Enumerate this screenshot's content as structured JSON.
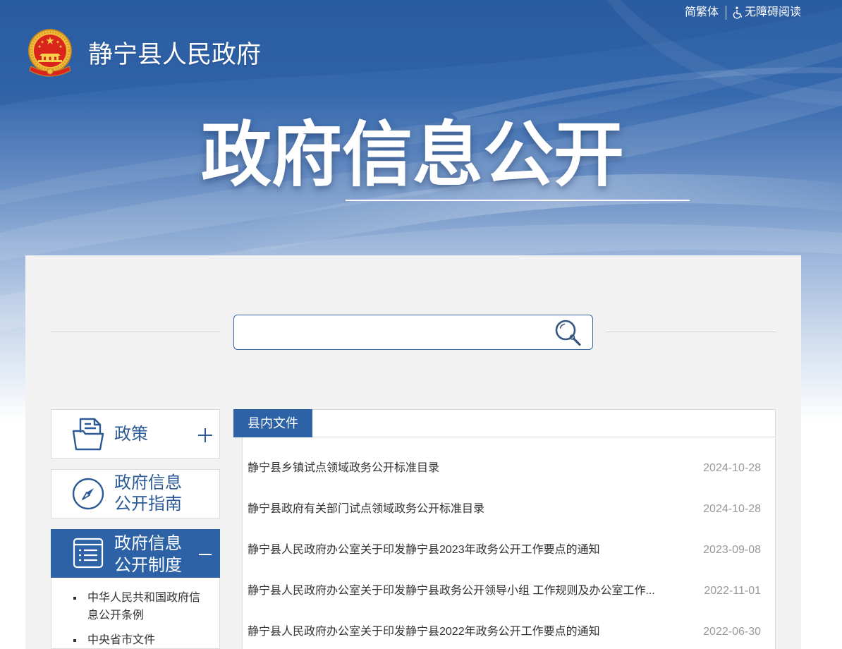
{
  "top_links": {
    "lang_switch": "简繁体",
    "accessibility": "无障碍阅读",
    "accessibility_icon": "wheelchair-icon"
  },
  "site": {
    "title": "静宁县人民政府",
    "emblem_icon": "national-emblem-icon"
  },
  "banner": {
    "title": "政府信息公开"
  },
  "search": {
    "value": "",
    "icon": "search-icon"
  },
  "sidebar": {
    "items": [
      {
        "label": "政策",
        "icon": "policy-folder-icon",
        "toggle_icon": "plus-icon",
        "active": false
      },
      {
        "label": "政府信息公开指南",
        "icon": "compass-icon",
        "active": false
      },
      {
        "label": "政府信息公开制度",
        "icon": "list-document-icon",
        "toggle_icon": "minus-icon",
        "active": true
      }
    ],
    "sub_items": [
      {
        "label": "中华人民共和国政府信息公开条例"
      },
      {
        "label": "中央省市文件"
      }
    ]
  },
  "main": {
    "tab": "县内文件",
    "articles": [
      {
        "title": "静宁县乡镇试点领域政务公开标准目录",
        "date": "2024-10-28"
      },
      {
        "title": "静宁县政府有关部门试点领域政务公开标准目录",
        "date": "2024-10-28"
      },
      {
        "title": "静宁县人民政府办公室关于印发静宁县2023年政务公开工作要点的通知",
        "date": "2023-09-08"
      },
      {
        "title": "静宁县人民政府办公室关于印发静宁县政务公开领导小组 工作规则及办公室工作...",
        "date": "2022-11-01"
      },
      {
        "title": "静宁县人民政府办公室关于印发静宁县2022年政务公开工作要点的通知",
        "date": "2022-06-30"
      }
    ]
  },
  "colors": {
    "accent_blue": "#2d63a6",
    "link_blue": "#2b5a96",
    "header_blue": "#2e60a6",
    "panel_gray": "#f2f2f2",
    "border_gray": "#dcdcdc",
    "text_dark": "#333333",
    "date_gray": "#999999",
    "search_border": "#3467a8"
  }
}
